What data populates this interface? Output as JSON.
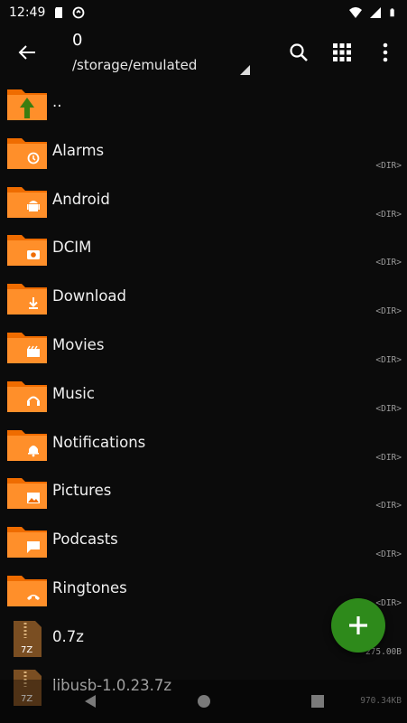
{
  "status_bar": {
    "time": "12:49",
    "icons": [
      "sd-card-icon",
      "data-saver-icon",
      "wifi-icon",
      "signal-icon",
      "battery-icon"
    ]
  },
  "header": {
    "title": "0",
    "path": "/storage/emulated",
    "actions": [
      "search-icon",
      "grid-view-icon",
      "more-vert-icon"
    ]
  },
  "files": {
    "parent": {
      "name": ".."
    },
    "items": [
      {
        "name": "Alarms",
        "meta": "<DIR>",
        "icon": "alarm-icon"
      },
      {
        "name": "Android",
        "meta": "<DIR>",
        "icon": "android-icon"
      },
      {
        "name": "DCIM",
        "meta": "<DIR>",
        "icon": "camera-icon"
      },
      {
        "name": "Download",
        "meta": "<DIR>",
        "icon": "download-icon"
      },
      {
        "name": "Movies",
        "meta": "<DIR>",
        "icon": "movie-icon"
      },
      {
        "name": "Music",
        "meta": "<DIR>",
        "icon": "headphones-icon"
      },
      {
        "name": "Notifications",
        "meta": "<DIR>",
        "icon": "bell-icon"
      },
      {
        "name": "Pictures",
        "meta": "<DIR>",
        "icon": "image-icon"
      },
      {
        "name": "Podcasts",
        "meta": "<DIR>",
        "icon": "chat-icon"
      },
      {
        "name": "Ringtones",
        "meta": "<DIR>",
        "icon": "phone-ring-icon"
      },
      {
        "name": "0.7z",
        "meta": "275.00B",
        "icon": "archive-icon"
      },
      {
        "name": "libusb-1.0.23.7z",
        "meta": "970.34KB",
        "icon": "archive-icon"
      }
    ]
  },
  "colors": {
    "folder": "#ef6c00",
    "folder_tab": "#ff8f2a",
    "up_arrow": "#3a7d10",
    "fab": "#2e8a1b",
    "archive": "#7a4e22"
  }
}
